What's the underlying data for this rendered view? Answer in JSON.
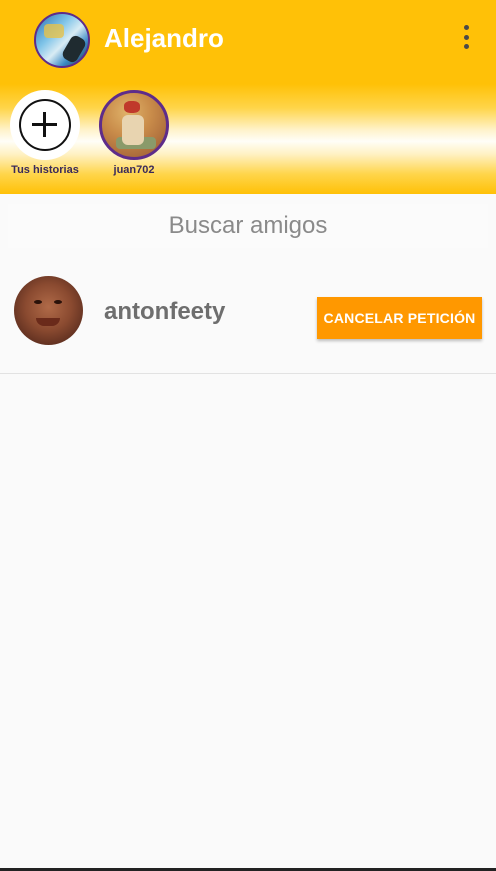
{
  "header": {
    "title": "Alejandro",
    "avatar_icon": "user-avatar",
    "menu_icon": "more-vert-icon",
    "background_color": "#ffc107"
  },
  "stories": {
    "items": [
      {
        "label": "Tus historias",
        "icon": "add-circle-icon"
      },
      {
        "label": "juan702",
        "icon": "user-avatar"
      }
    ]
  },
  "search": {
    "label": "Buscar amigos"
  },
  "friends": {
    "rows": [
      {
        "name": "antonfeety",
        "action_label": "CANCELAR PETICIÓN",
        "action_color": "#ff9800"
      }
    ]
  }
}
